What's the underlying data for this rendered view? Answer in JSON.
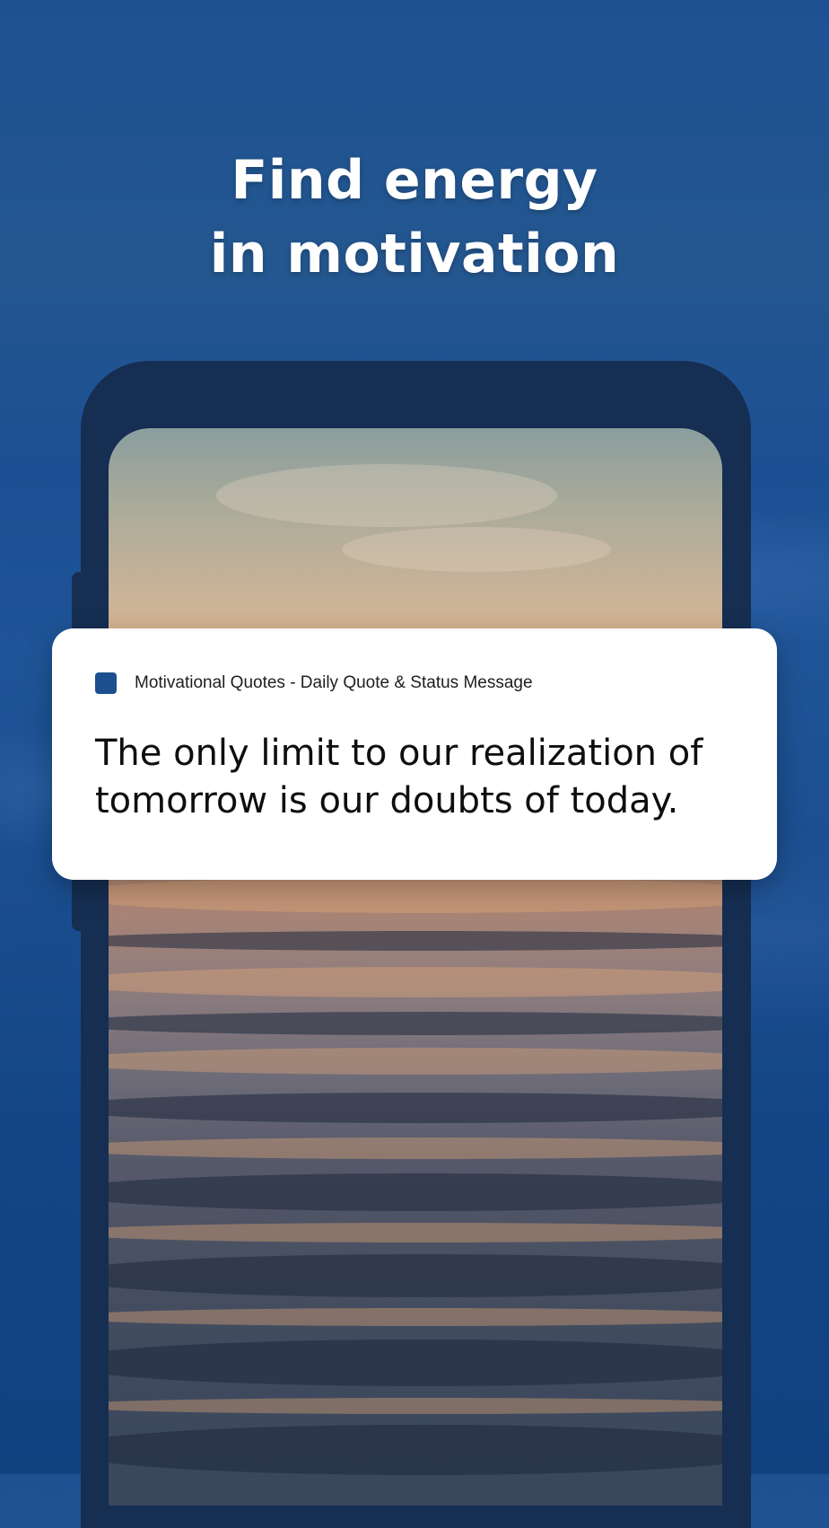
{
  "headline": {
    "line1": "Find energy",
    "line2": "in motivation"
  },
  "notification": {
    "app_name": "Motivational Quotes - Daily Quote & Status Message",
    "quote": "The only limit to our realization of tomorrow is our doubts of today."
  },
  "colors": {
    "background": "#1b4f93",
    "phone_frame": "#152e52",
    "app_icon": "#1b4f8e",
    "card": "#ffffff"
  }
}
